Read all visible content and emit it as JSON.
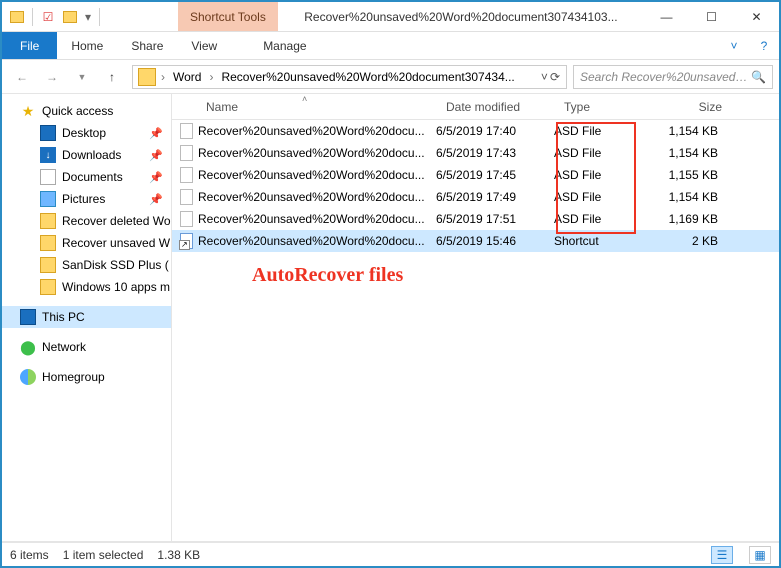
{
  "window": {
    "title": "Recover%20unsaved%20Word%20document307434103...",
    "context_tab": "Shortcut Tools"
  },
  "ribbon": {
    "file": "File",
    "tabs": [
      "Home",
      "Share",
      "View"
    ],
    "context": "Manage"
  },
  "address": {
    "segments": [
      "Word",
      "Recover%20unsaved%20Word%20document307434..."
    ]
  },
  "search": {
    "placeholder": "Search Recover%20unsaved%..."
  },
  "sidebar": {
    "quick": "Quick access",
    "quick_items": [
      {
        "label": "Desktop",
        "icon": "monitor",
        "pin": true
      },
      {
        "label": "Downloads",
        "icon": "down",
        "pin": true
      },
      {
        "label": "Documents",
        "icon": "doc",
        "pin": true
      },
      {
        "label": "Pictures",
        "icon": "pic",
        "pin": true
      },
      {
        "label": "Recover deleted Wo",
        "icon": "folder"
      },
      {
        "label": "Recover unsaved W",
        "icon": "folder"
      },
      {
        "label": "SanDisk SSD Plus (",
        "icon": "folder"
      },
      {
        "label": "Windows 10 apps m",
        "icon": "folder"
      }
    ],
    "thispc": "This PC",
    "network": "Network",
    "homegroup": "Homegroup"
  },
  "columns": {
    "name": "Name",
    "date": "Date modified",
    "type": "Type",
    "size": "Size"
  },
  "files": [
    {
      "name": "Recover%20unsaved%20Word%20docu...",
      "date": "6/5/2019 17:40",
      "type": "ASD File",
      "size": "1,154 KB",
      "icon": "file"
    },
    {
      "name": "Recover%20unsaved%20Word%20docu...",
      "date": "6/5/2019 17:43",
      "type": "ASD File",
      "size": "1,154 KB",
      "icon": "file"
    },
    {
      "name": "Recover%20unsaved%20Word%20docu...",
      "date": "6/5/2019 17:45",
      "type": "ASD File",
      "size": "1,155 KB",
      "icon": "file"
    },
    {
      "name": "Recover%20unsaved%20Word%20docu...",
      "date": "6/5/2019 17:49",
      "type": "ASD File",
      "size": "1,154 KB",
      "icon": "file"
    },
    {
      "name": "Recover%20unsaved%20Word%20docu...",
      "date": "6/5/2019 17:51",
      "type": "ASD File",
      "size": "1,169 KB",
      "icon": "file"
    },
    {
      "name": "Recover%20unsaved%20Word%20docu...",
      "date": "6/5/2019 15:46",
      "type": "Shortcut",
      "size": "2 KB",
      "icon": "shortcut",
      "selected": true
    }
  ],
  "annotation": "AutoRecover files",
  "status": {
    "count": "6 items",
    "selection": "1 item selected",
    "size": "1.38 KB"
  }
}
